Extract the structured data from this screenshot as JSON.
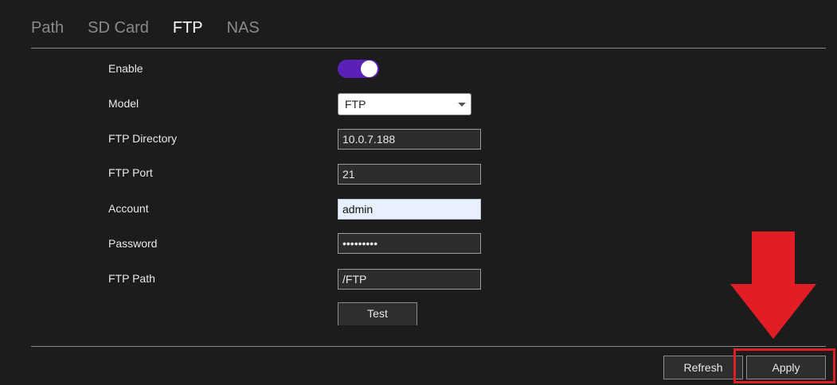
{
  "tabs": [
    {
      "label": "Path",
      "active": false
    },
    {
      "label": "SD Card",
      "active": false
    },
    {
      "label": "FTP",
      "active": true
    },
    {
      "label": "NAS",
      "active": false
    }
  ],
  "form": {
    "enable": {
      "label": "Enable",
      "value": true
    },
    "model": {
      "label": "Model",
      "value": "FTP"
    },
    "ftp_directory": {
      "label": "FTP Directory",
      "value": "10.0.7.188"
    },
    "ftp_port": {
      "label": "FTP Port",
      "value": "21"
    },
    "account": {
      "label": "Account",
      "value": "admin"
    },
    "password": {
      "label": "Password",
      "value": "•••••••••"
    },
    "ftp_path": {
      "label": "FTP Path",
      "value": "/FTP"
    },
    "test_label": "Test"
  },
  "footer": {
    "refresh_label": "Refresh",
    "apply_label": "Apply"
  },
  "annotation": {
    "arrow_icon": "down-arrow-icon",
    "color": "#e11d26"
  },
  "colors": {
    "background": "#1c1c1c",
    "toggle_on": "#5b21b6",
    "accent_red": "#e11d26"
  }
}
